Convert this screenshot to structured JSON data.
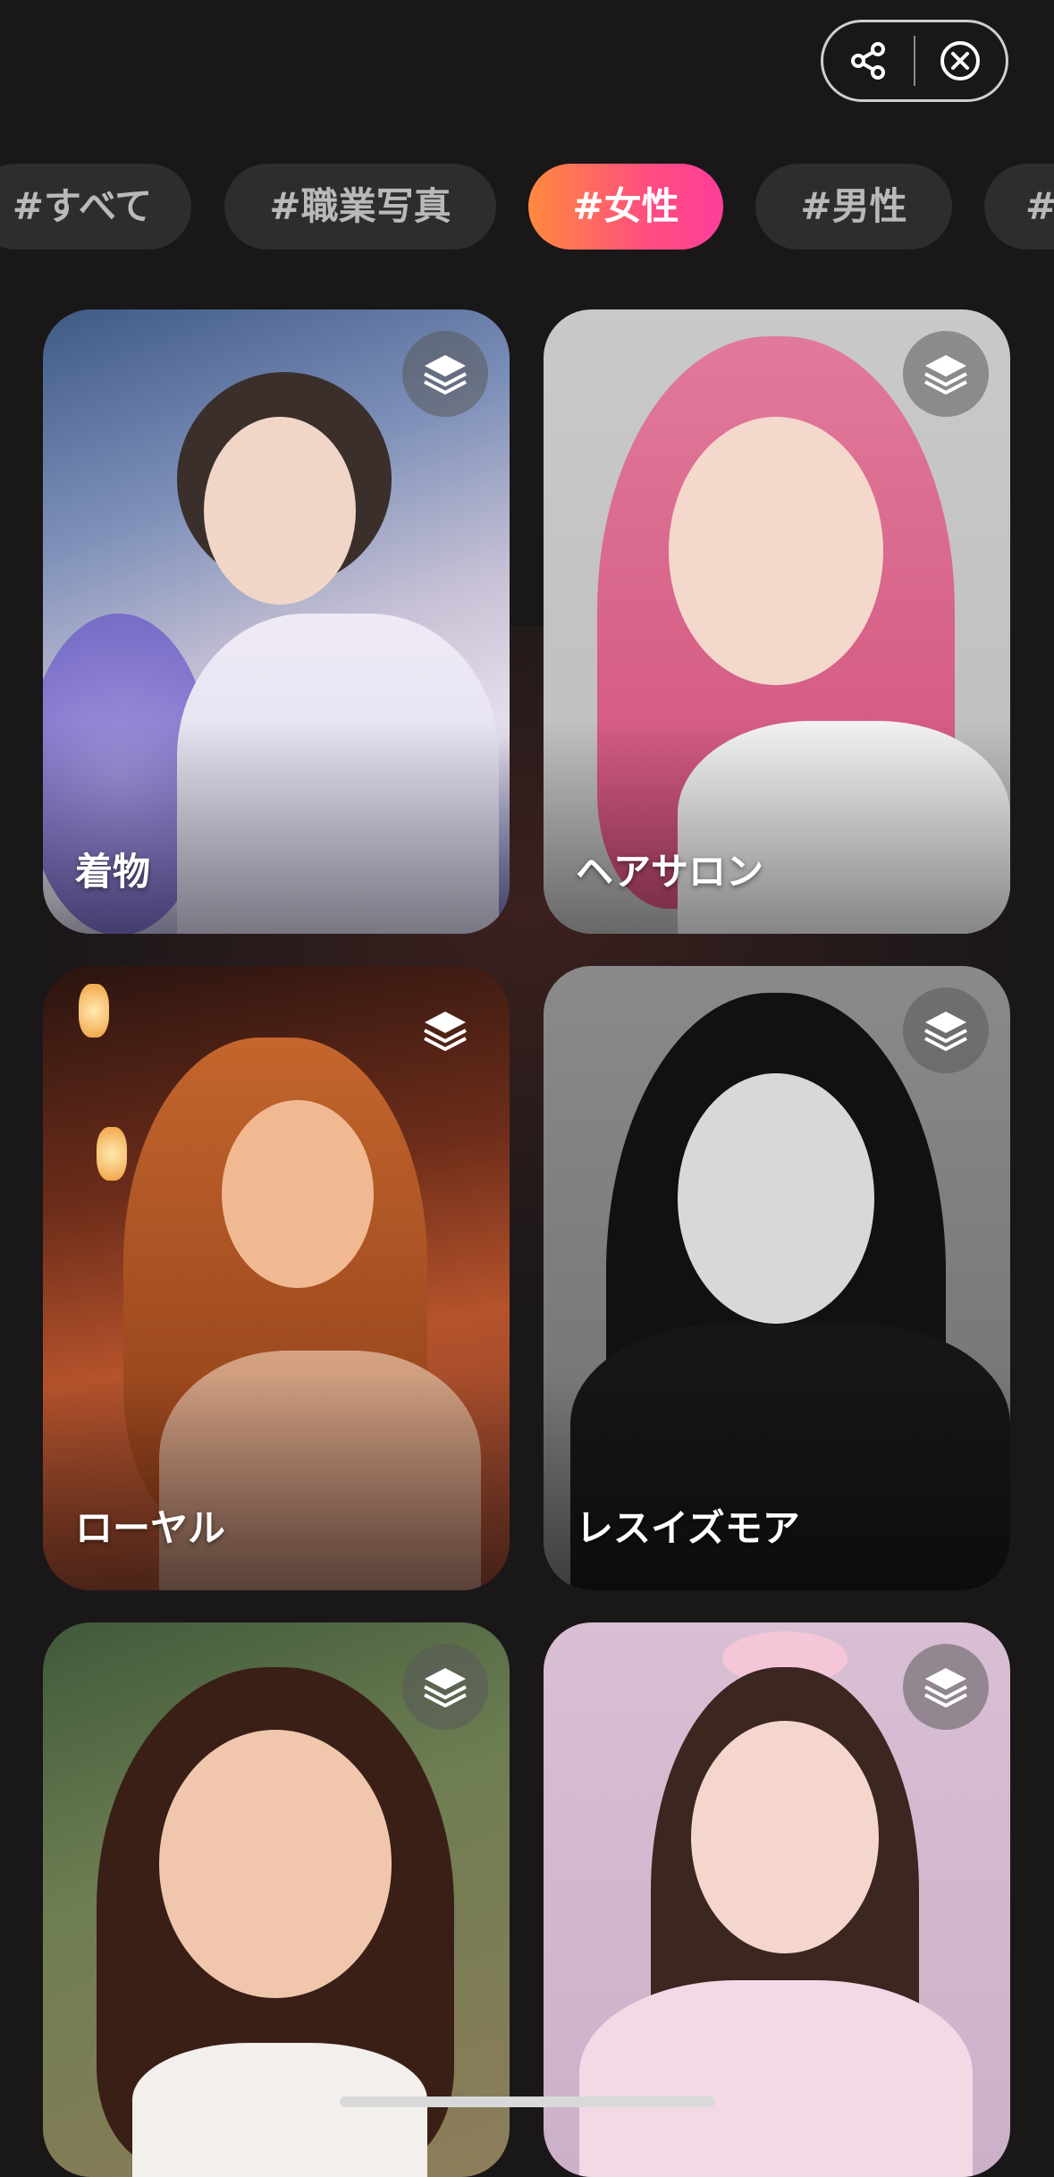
{
  "tags": [
    {
      "label": "#すべて",
      "active": false
    },
    {
      "label": "#職業写真",
      "active": false
    },
    {
      "label": "#女性",
      "active": true
    },
    {
      "label": "#男性",
      "active": false
    },
    {
      "label": "#",
      "active": false
    }
  ],
  "cards": [
    {
      "label": "着物"
    },
    {
      "label": "ヘアサロン"
    },
    {
      "label": "ローヤル"
    },
    {
      "label": "レスイズモア"
    },
    {
      "label": ""
    },
    {
      "label": ""
    }
  ],
  "icons": {
    "share": "share-icon",
    "close": "close-circle-icon",
    "layers": "layers-icon"
  },
  "colors": {
    "background": "#1a1719",
    "tag_inactive": "#2f2c2e",
    "tag_active_start": "#ff8a3d",
    "tag_active_end": "#ff3d9a"
  }
}
